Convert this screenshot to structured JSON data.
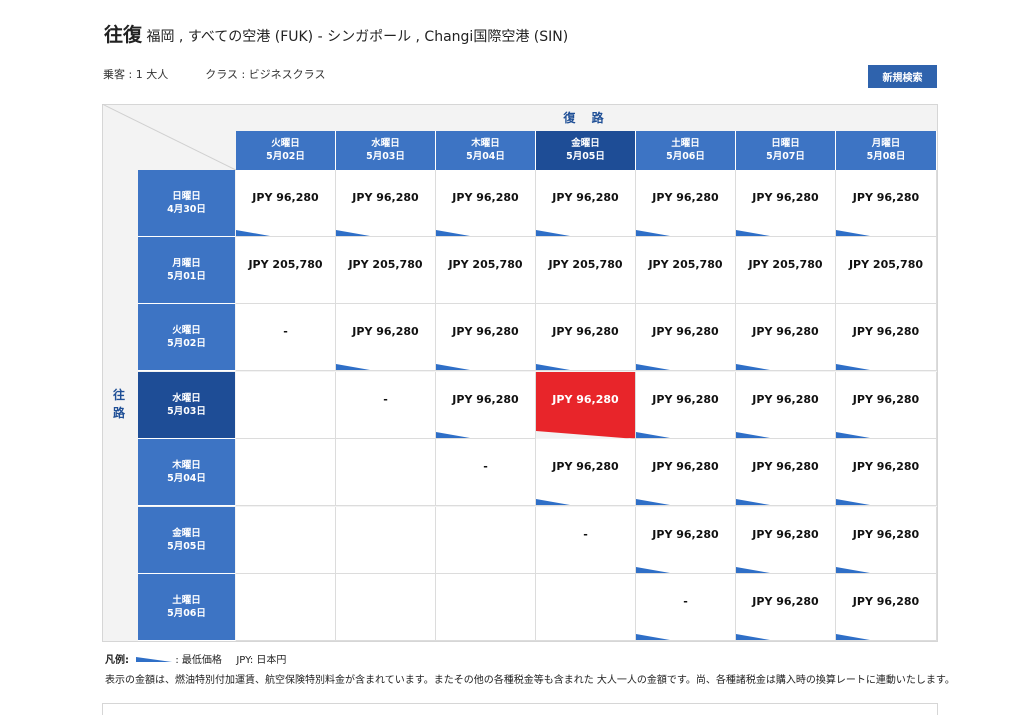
{
  "header": {
    "trip_type": "往復",
    "route": "福岡 , すべての空港 (FUK) - シンガポール , Changi国際空港 (SIN)"
  },
  "meta": {
    "passengers": "乗客 : 1 大人",
    "cabin_class": "クラス : ビジネスクラス"
  },
  "new_search_label": "新規検索",
  "grid": {
    "return_label": "復 路",
    "outbound_label": "往\n路",
    "columns": [
      {
        "day": "火曜日",
        "date": "5月02日",
        "selected": false
      },
      {
        "day": "水曜日",
        "date": "5月03日",
        "selected": false
      },
      {
        "day": "木曜日",
        "date": "5月04日",
        "selected": false
      },
      {
        "day": "金曜日",
        "date": "5月05日",
        "selected": true
      },
      {
        "day": "土曜日",
        "date": "5月06日",
        "selected": false
      },
      {
        "day": "日曜日",
        "date": "5月07日",
        "selected": false
      },
      {
        "day": "月曜日",
        "date": "5月08日",
        "selected": false
      }
    ],
    "rows": [
      {
        "day": "日曜日",
        "date": "4月30日",
        "selected": false,
        "cells": [
          "JPY 96,280",
          "JPY 96,280",
          "JPY 96,280",
          "JPY 96,280",
          "JPY 96,280",
          "JPY 96,280",
          "JPY 96,280"
        ],
        "lowest": [
          true,
          true,
          true,
          true,
          true,
          true,
          true
        ]
      },
      {
        "day": "月曜日",
        "date": "5月01日",
        "selected": false,
        "cells": [
          "JPY 205,780",
          "JPY 205,780",
          "JPY 205,780",
          "JPY 205,780",
          "JPY 205,780",
          "JPY 205,780",
          "JPY 205,780"
        ],
        "lowest": [
          false,
          false,
          false,
          false,
          false,
          false,
          false
        ]
      },
      {
        "day": "火曜日",
        "date": "5月02日",
        "selected": false,
        "cells": [
          "-",
          "JPY 96,280",
          "JPY 96,280",
          "JPY 96,280",
          "JPY 96,280",
          "JPY 96,280",
          "JPY 96,280"
        ],
        "lowest": [
          false,
          true,
          true,
          true,
          true,
          true,
          true
        ]
      },
      {
        "day": "水曜日",
        "date": "5月03日",
        "selected": true,
        "cells": [
          "",
          "-",
          "JPY 96,280",
          "JPY 96,280",
          "JPY 96,280",
          "JPY 96,280",
          "JPY 96,280"
        ],
        "lowest": [
          false,
          false,
          true,
          false,
          true,
          true,
          true
        ]
      },
      {
        "day": "木曜日",
        "date": "5月04日",
        "selected": false,
        "cells": [
          "",
          "",
          "-",
          "JPY 96,280",
          "JPY 96,280",
          "JPY 96,280",
          "JPY 96,280"
        ],
        "lowest": [
          false,
          false,
          false,
          true,
          true,
          true,
          true
        ]
      },
      {
        "day": "金曜日",
        "date": "5月05日",
        "selected": false,
        "cells": [
          "",
          "",
          "",
          "-",
          "JPY 96,280",
          "JPY 96,280",
          "JPY 96,280"
        ],
        "lowest": [
          false,
          false,
          false,
          false,
          true,
          true,
          true
        ]
      },
      {
        "day": "土曜日",
        "date": "5月06日",
        "selected": false,
        "cells": [
          "",
          "",
          "",
          "",
          "-",
          "JPY 96,280",
          "JPY 96,280"
        ],
        "lowest": [
          false,
          false,
          false,
          false,
          true,
          true,
          true
        ]
      }
    ],
    "selected_cell": {
      "row": 3,
      "col": 3
    }
  },
  "legend": {
    "label": "凡例:",
    "lowest_label": ": 最低価格",
    "currency": "JPY: 日本円"
  },
  "note": "表示の金額は、燃油特別付加運賃、航空保険特別料金が含まれています。またその他の各種税金等も含まれた 大人一人の金額です。尚、各種諸税金は購入時の換算レートに連動いたします。",
  "colors": {
    "header_blue": "#3d74c4",
    "selected_blue": "#1e4d96",
    "selected_cell": "#e8252a",
    "lowest_marker": "#2f6fc7"
  }
}
